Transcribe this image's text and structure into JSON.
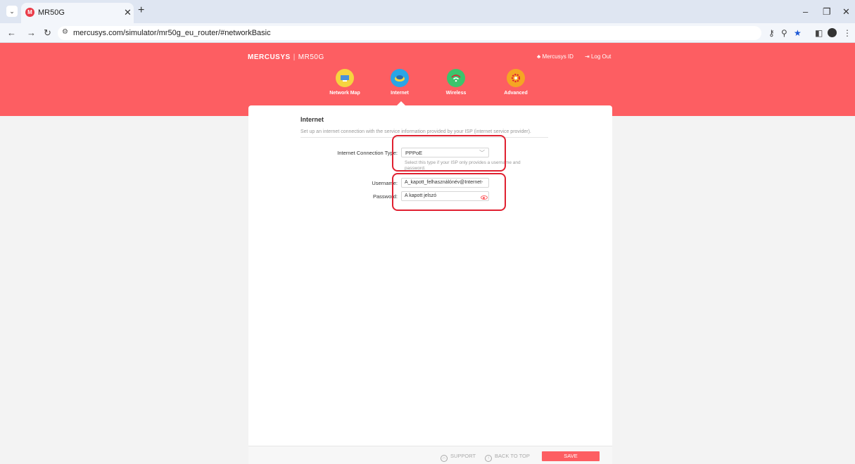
{
  "browser": {
    "tab_title": "MR50G",
    "tab_favicon": "M",
    "url": "mercusys.com/simulator/mr50g_eu_router/#networkBasic"
  },
  "header": {
    "brand": "MERCUSYS",
    "model": "MR50G",
    "mercusys_id": "Mercusys ID",
    "logout": "Log Out"
  },
  "nav": [
    {
      "label": "Network Map",
      "icon": "network-map-icon",
      "color": "#f6d43f"
    },
    {
      "label": "Internet",
      "icon": "globe-icon",
      "color": "#2aa5e6"
    },
    {
      "label": "Wireless",
      "icon": "wifi-icon",
      "color": "#3cc46c"
    },
    {
      "label": "Advanced",
      "icon": "gear-icon",
      "color": "#f5a623"
    }
  ],
  "internet": {
    "title": "Internet",
    "description": "Set up an internet connection with the service information provided by your ISP (internet service provider).",
    "connection_type_label": "Internet Connection Type:",
    "connection_type_value": "PPPoE",
    "hint": "Select this type if your ISP only provides a username and password.",
    "username_label": "Username:",
    "username_value": "A_kapott_felhasználónév@Internet-",
    "password_label": "Password:",
    "password_value": "A kapott jelszó"
  },
  "footer": {
    "support": "SUPPORT",
    "back_to_top": "BACK TO TOP",
    "save": "SAVE"
  },
  "colors": {
    "brand": "#fd5e62",
    "highlight": "#e02030"
  }
}
